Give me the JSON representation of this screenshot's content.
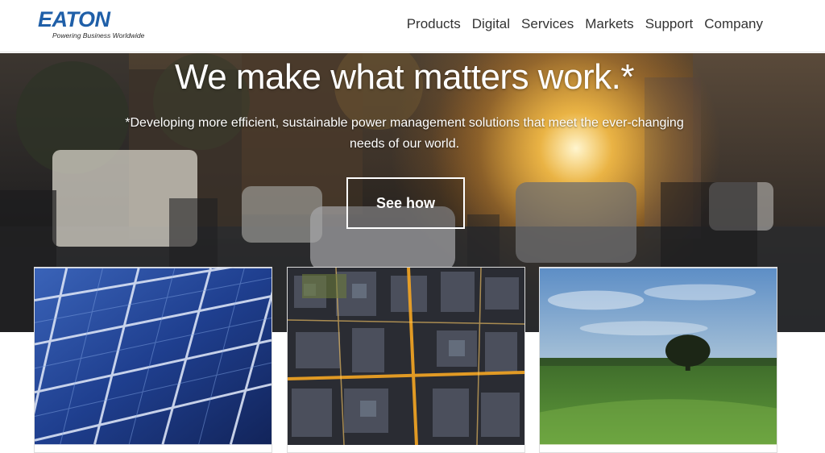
{
  "brand": {
    "name": "EATON",
    "tagline": "Powering Business Worldwide",
    "color": "#1f5fa8"
  },
  "nav": {
    "items": [
      "Products",
      "Digital",
      "Services",
      "Markets",
      "Support",
      "Company"
    ]
  },
  "hero": {
    "title": "We make what matters work.*",
    "subtitle": "*Developing more efficient, sustainable power management solutions that meet the ever-changing needs of our world.",
    "cta_label": "See how"
  },
  "cards": [
    {
      "image": "solar-panel-closeup"
    },
    {
      "image": "city-aerial-night"
    },
    {
      "image": "tree-field-sunset"
    }
  ]
}
